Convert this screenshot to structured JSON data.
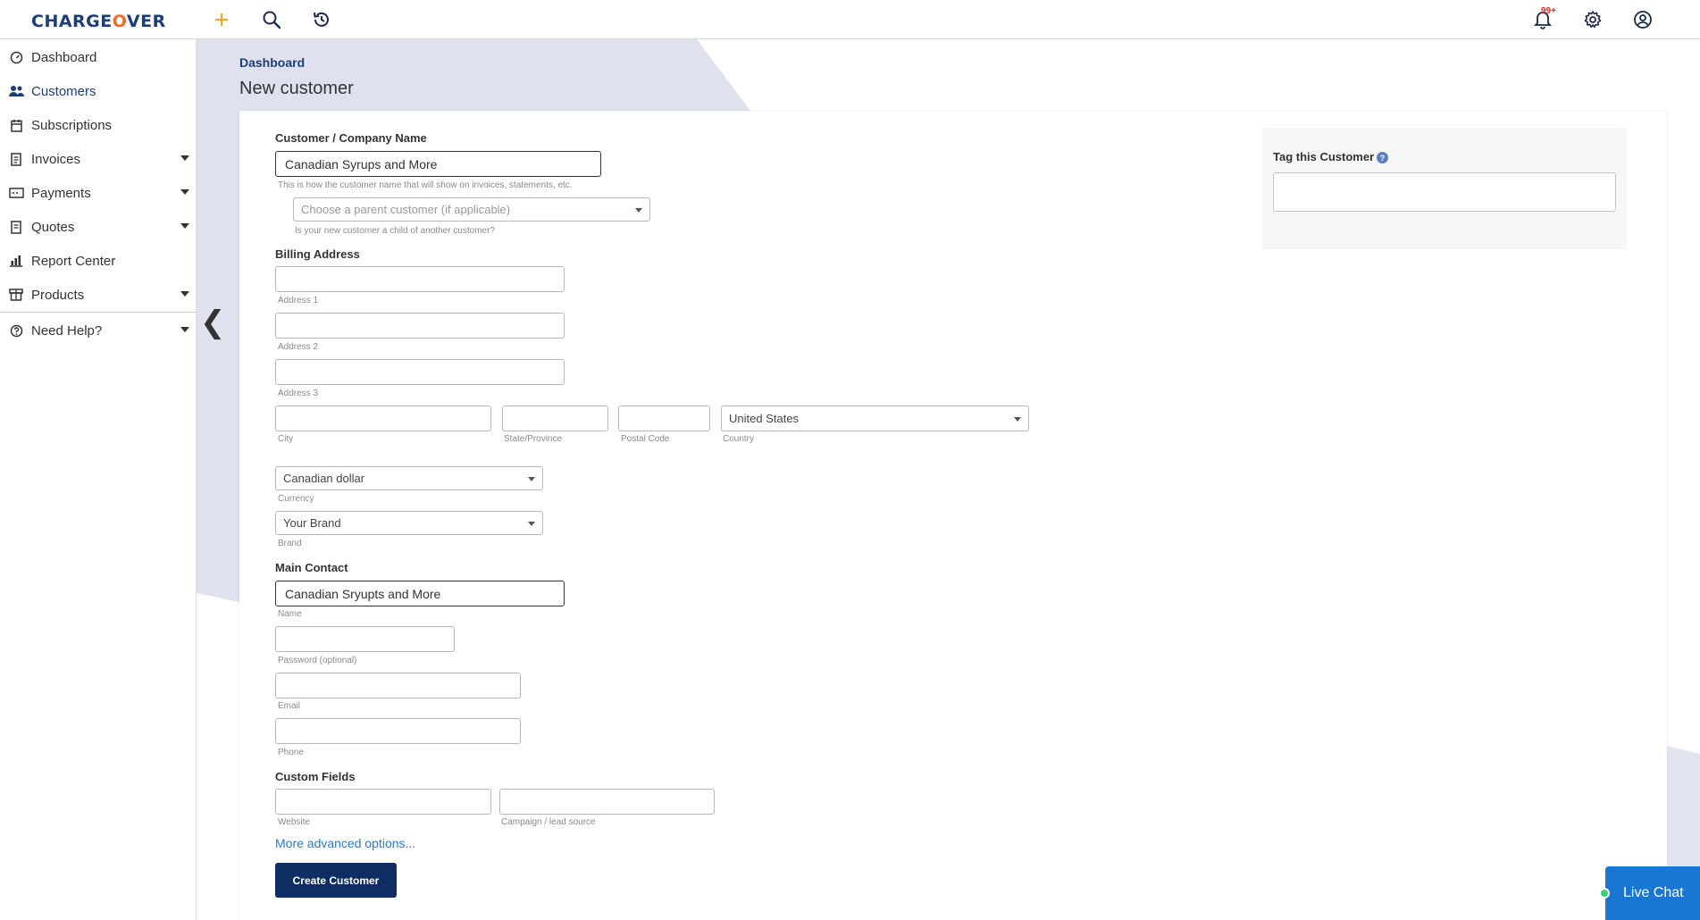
{
  "app": {
    "logo_main": "CHARGE",
    "logo_o": "O",
    "logo_end": "VER",
    "notification_badge": "99+"
  },
  "sidebar": {
    "items": [
      {
        "label": "Dashboard",
        "icon": "gauge-icon"
      },
      {
        "label": "Customers",
        "icon": "users-icon"
      },
      {
        "label": "Subscriptions",
        "icon": "calendar-icon"
      },
      {
        "label": "Invoices",
        "icon": "invoice-icon"
      },
      {
        "label": "Payments",
        "icon": "payment-card-icon"
      },
      {
        "label": "Quotes",
        "icon": "quote-icon"
      },
      {
        "label": "Report Center",
        "icon": "report-chart-icon"
      },
      {
        "label": "Products",
        "icon": "box-icon"
      },
      {
        "label": "Need Help?",
        "icon": "question-circle-icon"
      }
    ],
    "collapse_glyph": "❮"
  },
  "header": {
    "breadcrumb": "Dashboard",
    "title": "New customer"
  },
  "form": {
    "company_label": "Customer / Company Name",
    "company_value": "Canadian Syrups and More",
    "company_hint": "This is how the customer name that will show on invoices, statements, etc.",
    "parent_placeholder": "Choose a parent customer (if applicable)",
    "parent_hint": "Is your new customer a child of another customer?",
    "billing_label": "Billing Address",
    "address1_hint": "Address 1",
    "address2_hint": "Address 2",
    "address3_hint": "Address 3",
    "city_hint": "City",
    "state_hint": "State/Province",
    "postal_hint": "Postal Code",
    "country_value": "United States",
    "country_hint": "Country",
    "currency_value": "Canadian dollar",
    "currency_hint": "Currency",
    "brand_value": "Your Brand",
    "brand_hint": "Brand",
    "contact_label": "Main Contact",
    "contact_name_value": "Canadian Sryupts and More",
    "name_hint": "Name",
    "password_hint": "Password (optional)",
    "email_hint": "Email",
    "phone_hint": "Phone",
    "custom_label": "Custom Fields",
    "website_hint": "Website",
    "campaign_hint": "Campaign / lead source",
    "advanced_link": "More advanced options...",
    "submit_label": "Create Customer"
  },
  "tag_panel": {
    "label": "Tag this Customer",
    "help": "?"
  },
  "live_chat": {
    "label": "Live Chat"
  },
  "colors": {
    "brand_navy": "#1c3f7a",
    "brand_orange": "#f26b2a",
    "button_navy": "#0e2e63",
    "link_blue": "#2a7bc4",
    "chat_blue": "#1976d2"
  }
}
